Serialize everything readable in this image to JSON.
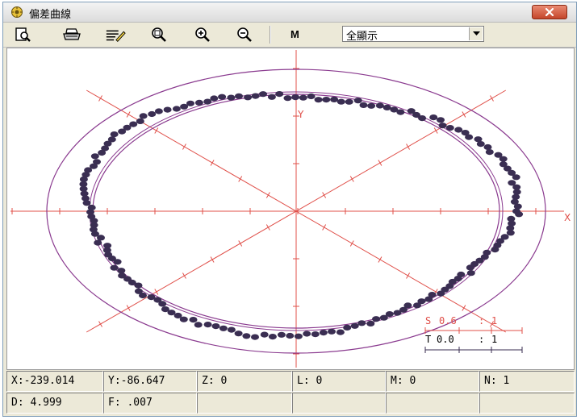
{
  "window": {
    "title": "偏差曲線"
  },
  "toolbar": {
    "buttons": [
      {
        "icon": "print-preview-icon"
      },
      {
        "icon": "printer-icon"
      },
      {
        "icon": "edit-lines-icon"
      },
      {
        "icon": "zoom-fit-icon"
      },
      {
        "icon": "zoom-in-icon"
      },
      {
        "icon": "zoom-out-icon"
      }
    ],
    "m_label": "M",
    "display_select": {
      "value": "全顯示"
    }
  },
  "plot": {
    "x_axis_label": "X",
    "y_axis_label": "Y",
    "scale_s": {
      "letter": "S",
      "value": "0.6",
      "sep": ":",
      "ratio": "1"
    },
    "scale_t": {
      "letter": "T",
      "value": "0.0",
      "sep": ":",
      "ratio": "1"
    }
  },
  "status": {
    "row1": [
      "X:-239.014",
      "Y:-86.647",
      "Z: 0",
      "L: 0",
      "M: 0",
      "N: 1"
    ],
    "row2": [
      "D: 4.999",
      "F: .007",
      "",
      "",
      "",
      ""
    ]
  },
  "colors": {
    "axis": "#e0504a",
    "circle": "#8a3a8f",
    "points": "#3a2e52",
    "close_button": "#c4462b"
  }
}
